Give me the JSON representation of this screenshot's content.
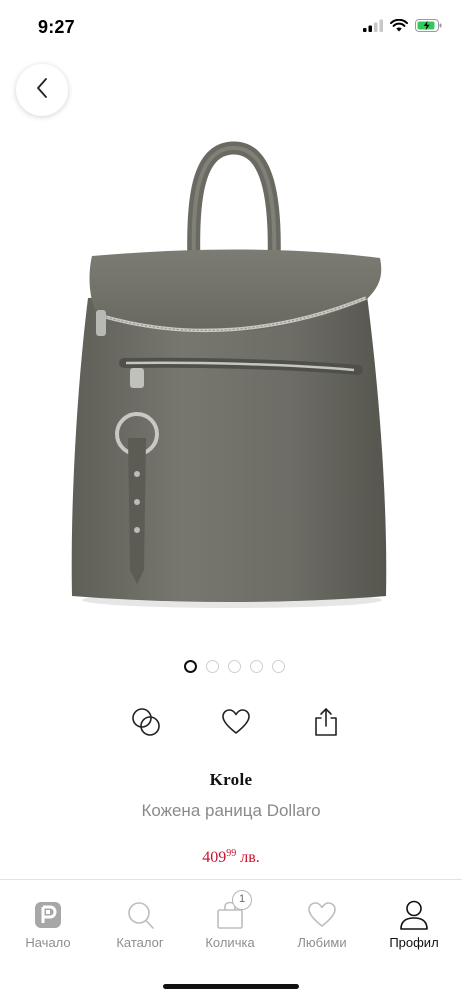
{
  "status_bar": {
    "time": "9:27"
  },
  "product": {
    "brand": "Krole",
    "name": "Кожена раница Dollaro",
    "price_main": "409",
    "price_cents": "99",
    "currency": "лв."
  },
  "gallery": {
    "total_images": 5,
    "active_index": 0
  },
  "colors": {
    "accent": "#c8102e",
    "bag": "#707068",
    "active_text": "#111111",
    "inactive_text": "#8e8e8e"
  },
  "tabs": [
    {
      "label": "Начало",
      "icon": "home-logo-icon",
      "active": false
    },
    {
      "label": "Каталог",
      "icon": "search-icon",
      "active": false
    },
    {
      "label": "Количка",
      "icon": "cart-bag-icon",
      "active": false,
      "badge": "1"
    },
    {
      "label": "Любими",
      "icon": "heart-icon",
      "active": false
    },
    {
      "label": "Профил",
      "icon": "profile-icon",
      "active": true
    }
  ]
}
